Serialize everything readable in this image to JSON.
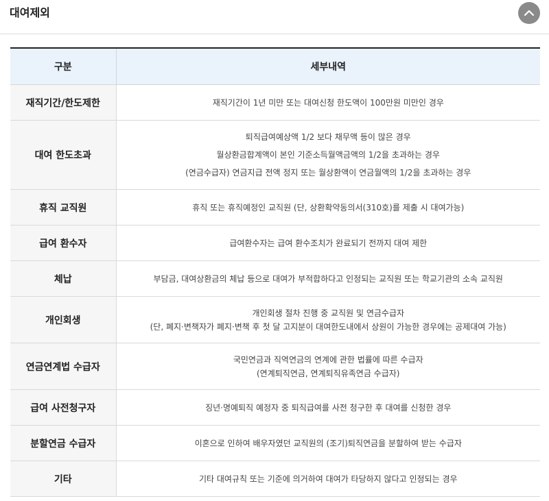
{
  "header": {
    "title": "대여제외",
    "collapse_icon": "chevron-up-icon"
  },
  "table": {
    "headers": [
      "구분",
      "세부내역"
    ],
    "rows": [
      {
        "category": "재직기간/한도제한",
        "details": [
          "재직기간이 1년 미만 또는 대여신청 한도액이 100만원 미만인 경우"
        ]
      },
      {
        "category": "대여 한도초과",
        "details": [
          "퇴직급여예상액 1/2 보다 채무액 등이 많은 경우",
          "월상환금합계액이 본인 기준소득월액금액의 1/2을 초과하는 경우",
          "(연금수급자) 연금지급 전액 정지 또는 월상환액이 연금월액의 1/2을 초과하는 경우"
        ]
      },
      {
        "category": "휴직 교직원",
        "details": [
          "휴직 또는 휴직예정인 교직원 (단, 상환확약동의서(310호)를 제출 시 대여가능)"
        ]
      },
      {
        "category": "급여 환수자",
        "details": [
          "급여환수자는 급여 환수조치가 완료되기 전까지 대여 제한"
        ]
      },
      {
        "category": "체납",
        "details": [
          "부담금, 대여상환금의 체납 등으로 대여가 부적합하다고 인정되는 교직원 또는 학교기관의 소속 교직원"
        ]
      },
      {
        "category": "개인회생",
        "details": [
          "개인회생 절차 진행 중 교직원 및 연금수급자",
          "(단, 폐지·변책자가 폐지·변책 후 첫 달 고지분이 대여한도내에서 상원이 가능한 경우에는 공제대여 가능)"
        ]
      },
      {
        "category": "연금연계법 수급자",
        "details": [
          "국민연금과 직역연금의 연계에 관한 법률에 따른 수급자",
          "(연계퇴직연금, 연계퇴직유족연금 수급자)"
        ]
      },
      {
        "category": "급여 사전청구자",
        "details": [
          "징년·명예퇴직 예정자 중 퇴직급여를 사전 청구한 후 대여를 신청한 경우"
        ]
      },
      {
        "category": "분할연금 수급자",
        "details": [
          "이혼으로 인하여 배우자였던 교직원의 (조기)퇴직연금을 분할하여 받는 수급자"
        ]
      },
      {
        "category": "기타",
        "details": [
          "기타 대여규칙 또는 기준에 의거하여 대여가 타당하지 않다고 인정되는 경우"
        ]
      }
    ]
  }
}
